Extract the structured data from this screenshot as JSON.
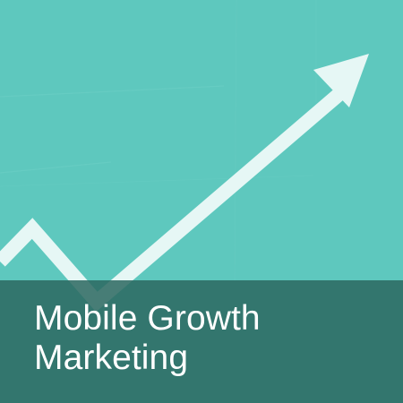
{
  "title": {
    "line1": "Mobile Growth",
    "line2": "Marketing"
  },
  "colors": {
    "background": "#5ec8be",
    "arrow": "#e6f7f5",
    "caption_band": "#2c6961",
    "caption_text": "#ffffff"
  },
  "icons": {
    "main_graphic": "upward-trend-arrow-icon"
  }
}
